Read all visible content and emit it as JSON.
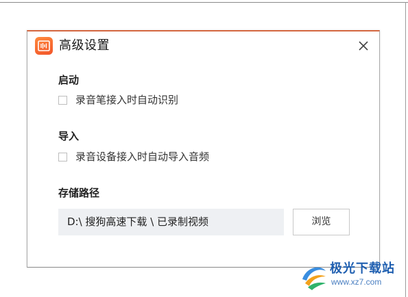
{
  "dialog": {
    "title": "高级设置",
    "app_icon": "recorder-app-icon",
    "close_icon": "close-icon"
  },
  "sections": {
    "startup": {
      "label": "启动",
      "option_label": "录音笔接入时自动识别",
      "checked": false
    },
    "import": {
      "label": "导入",
      "option_label": "录音设备接入时自动导入音频",
      "checked": false
    },
    "storage": {
      "label": "存储路径",
      "path_value": "D:\\ 搜狗高速下载 \\ 已录制视频",
      "browse_label": "浏览"
    }
  },
  "watermark": {
    "name": "极光下载站",
    "url": "www.xz7.com",
    "logo_icon": "aurora-logo-icon"
  },
  "colors": {
    "accent": "#f2552a",
    "dialog_border": "#d4663f",
    "field_bg": "#eef0f3",
    "watermark_blue": "#1f5fb0"
  }
}
